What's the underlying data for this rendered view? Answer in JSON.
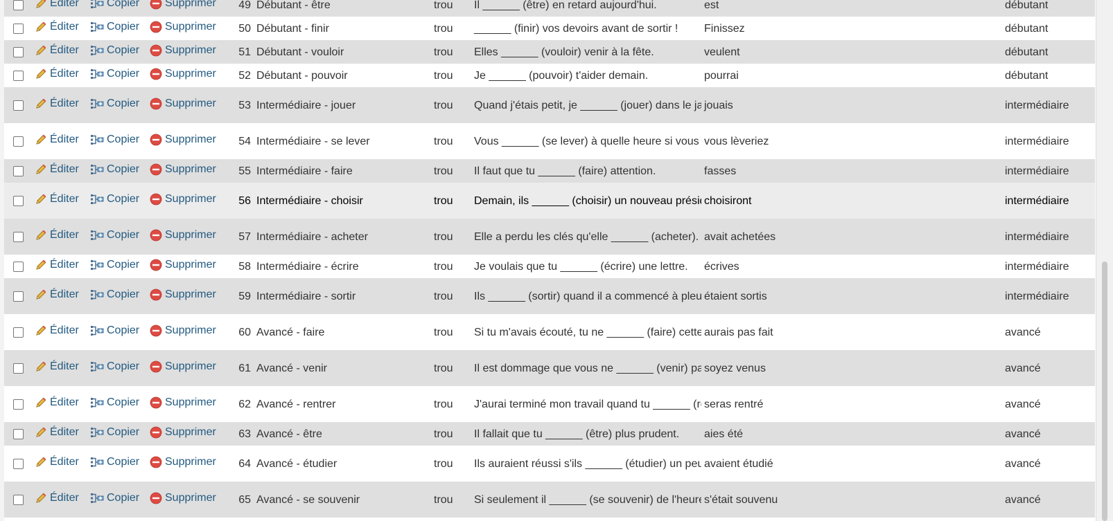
{
  "actions": {
    "edit": "Éditer",
    "copy": "Copier",
    "delete": "Supprimer"
  },
  "colors": {
    "link": "#235a81",
    "row_odd": "#dfdfdf",
    "row_even": "#ffffff",
    "row_hover": "#ececec"
  },
  "rows": [
    {
      "id": "49",
      "title": "Débutant - être",
      "type": "trou",
      "question": "Il ______ (être) en retard aujourd'hui.",
      "answer": "est",
      "level": "débutant"
    },
    {
      "id": "50",
      "title": "Débutant - finir",
      "type": "trou",
      "question": "______ (finir) vos devoirs avant de sortir !",
      "answer": "Finissez",
      "level": "débutant"
    },
    {
      "id": "51",
      "title": "Débutant - vouloir",
      "type": "trou",
      "question": "Elles ______ (vouloir) venir à la fête.",
      "answer": "veulent",
      "level": "débutant"
    },
    {
      "id": "52",
      "title": "Débutant - pouvoir",
      "type": "trou",
      "question": "Je ______ (pouvoir) t'aider demain.",
      "answer": "pourrai",
      "level": "débutant"
    },
    {
      "id": "53",
      "title": "Intermédiaire - jouer",
      "type": "trou",
      "question": "Quand j'étais petit, je ______ (jouer) dans le jar...",
      "answer": "jouais",
      "level": "intermédiaire"
    },
    {
      "id": "54",
      "title": "Intermédiaire - se lever",
      "type": "trou",
      "question": "Vous ______ (se lever) à quelle heure si vous étie...",
      "answer": "vous lèveriez",
      "level": "intermédiaire"
    },
    {
      "id": "55",
      "title": "Intermédiaire - faire",
      "type": "trou",
      "question": "Il faut que tu ______ (faire) attention.",
      "answer": "fasses",
      "level": "intermédiaire"
    },
    {
      "id": "56",
      "title": "Intermédiaire - choisir",
      "type": "trou",
      "question": "Demain, ils ______ (choisir) un nouveau président.",
      "answer": "choisiront",
      "level": "intermédiaire"
    },
    {
      "id": "57",
      "title": "Intermédiaire - acheter",
      "type": "trou",
      "question": "Elle a perdu les clés qu'elle ______ (acheter).",
      "answer": "avait achetées",
      "level": "intermédiaire"
    },
    {
      "id": "58",
      "title": "Intermédiaire - écrire",
      "type": "trou",
      "question": "Je voulais que tu ______ (écrire) une lettre.",
      "answer": "écrives",
      "level": "intermédiaire"
    },
    {
      "id": "59",
      "title": "Intermédiaire - sortir",
      "type": "trou",
      "question": "Ils ______ (sortir) quand il a commencé à pleuvoir...",
      "answer": "étaient sortis",
      "level": "intermédiaire"
    },
    {
      "id": "60",
      "title": "Avancé - faire",
      "type": "trou",
      "question": "Si tu m'avais écouté, tu ne ______ (faire) cette e...",
      "answer": "aurais pas fait",
      "level": "avancé"
    },
    {
      "id": "61",
      "title": "Avancé - venir",
      "type": "trou",
      "question": "Il est dommage que vous ne ______ (venir) pas plus...",
      "answer": "soyez venus",
      "level": "avancé"
    },
    {
      "id": "62",
      "title": "Avancé - rentrer",
      "type": "trou",
      "question": "J'aurai terminé mon travail quand tu ______ (rentr...",
      "answer": "seras rentré",
      "level": "avancé"
    },
    {
      "id": "63",
      "title": "Avancé - être",
      "type": "trou",
      "question": "Il fallait que tu ______ (être) plus prudent.",
      "answer": "aies été",
      "level": "avancé"
    },
    {
      "id": "64",
      "title": "Avancé - étudier",
      "type": "trou",
      "question": "Ils auraient réussi s'ils ______ (étudier) un peu ...",
      "answer": "avaient étudié",
      "level": "avancé"
    },
    {
      "id": "65",
      "title": "Avancé - se souvenir",
      "type": "trou",
      "question": "Si seulement il ______ (se souvenir) de l'heure du...",
      "answer": "s'était souvenu",
      "level": "avancé"
    }
  ]
}
